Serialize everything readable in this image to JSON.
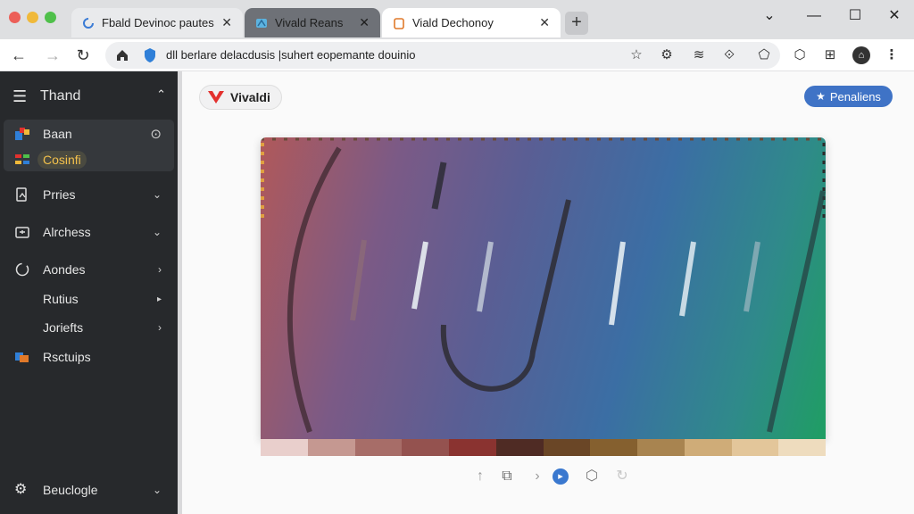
{
  "tabs": [
    {
      "title": "Fbald Devinoc pautes",
      "active": false
    },
    {
      "title": "Vivald Reans",
      "active": false
    },
    {
      "title": "Viald Dechonoy",
      "active": true
    }
  ],
  "address": {
    "url": "dll berlare delacdusis |suhert eopemante douinio"
  },
  "sidebar": {
    "header": "Thand",
    "items": [
      {
        "label": "Baan"
      },
      {
        "label": "Cosinfi"
      },
      {
        "label": "Prries"
      },
      {
        "label": "Alrchess"
      },
      {
        "label": "Aondes"
      },
      {
        "label": "Rutius"
      },
      {
        "label": "Joriefts"
      },
      {
        "label": "Rsctuips"
      }
    ],
    "footer": "Beuclogle"
  },
  "main": {
    "brand": "Vivaldi",
    "premium_label": "Penaliens"
  },
  "colors": {
    "accent": "#3f73c6",
    "brand_red": "#e3312e",
    "sidebar_bg": "#27292c",
    "swatches": [
      "#e9cfcc",
      "#c59891",
      "#a76d68",
      "#94524f",
      "#8a3330",
      "#4f2b24",
      "#6a4626",
      "#85602f",
      "#a88450",
      "#cfac78",
      "#e3c69a",
      "#eedcbe"
    ]
  }
}
